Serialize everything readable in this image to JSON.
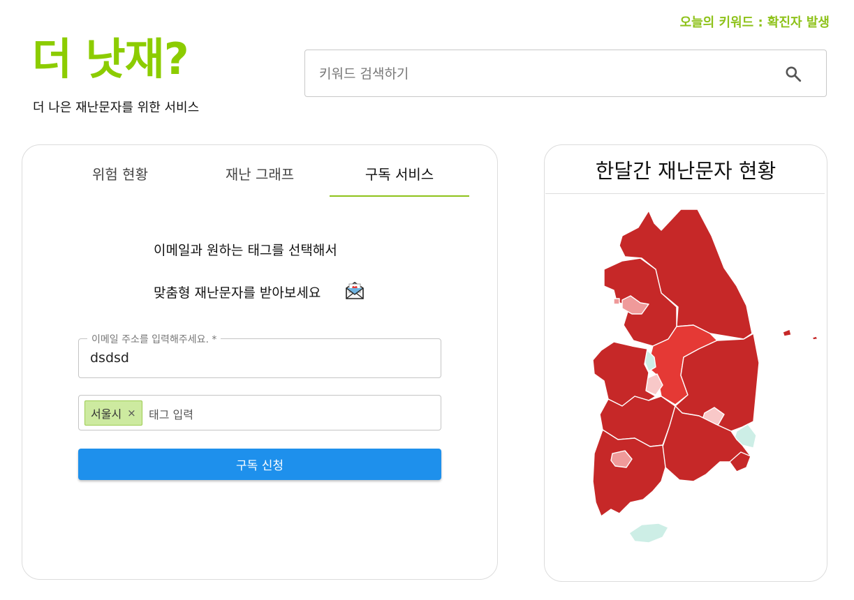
{
  "header": {
    "keyword_today": "오늘의 키워드 : 확진자 발생",
    "logo": "더 낫재?",
    "tagline": "더 나은 재난문자를 위한 서비스"
  },
  "search": {
    "placeholder": "키워드 검색하기",
    "icon": "search-icon"
  },
  "tabs": [
    {
      "label": "위험 현황",
      "active": false
    },
    {
      "label": "재난 그래프",
      "active": false
    },
    {
      "label": "구독 서비스",
      "active": true
    }
  ],
  "subscribe": {
    "line1": "이메일과 원하는 태그를 선택해서",
    "line2": "맞춤형 재난문자를 받아보세요",
    "line2_icon": "love-letter-icon",
    "email_label": "이메일 주소를 입력해주세요. *",
    "email_value": "dsdsd",
    "tags": [
      "서울시"
    ],
    "tag_remove": "×",
    "tag_placeholder": "태그 입력",
    "button": "구독 신청"
  },
  "map": {
    "title": "한달간 재난문자 현황"
  },
  "colors": {
    "brand_green": "#8ccc00",
    "keyword_green": "#8ec21a",
    "button_blue": "#1e90ec",
    "map_high": "#c62828",
    "map_mid": "#e53935",
    "map_low": "#ef9a9a",
    "map_lower": "#f8c8c8",
    "map_none": "#cdeee6"
  }
}
